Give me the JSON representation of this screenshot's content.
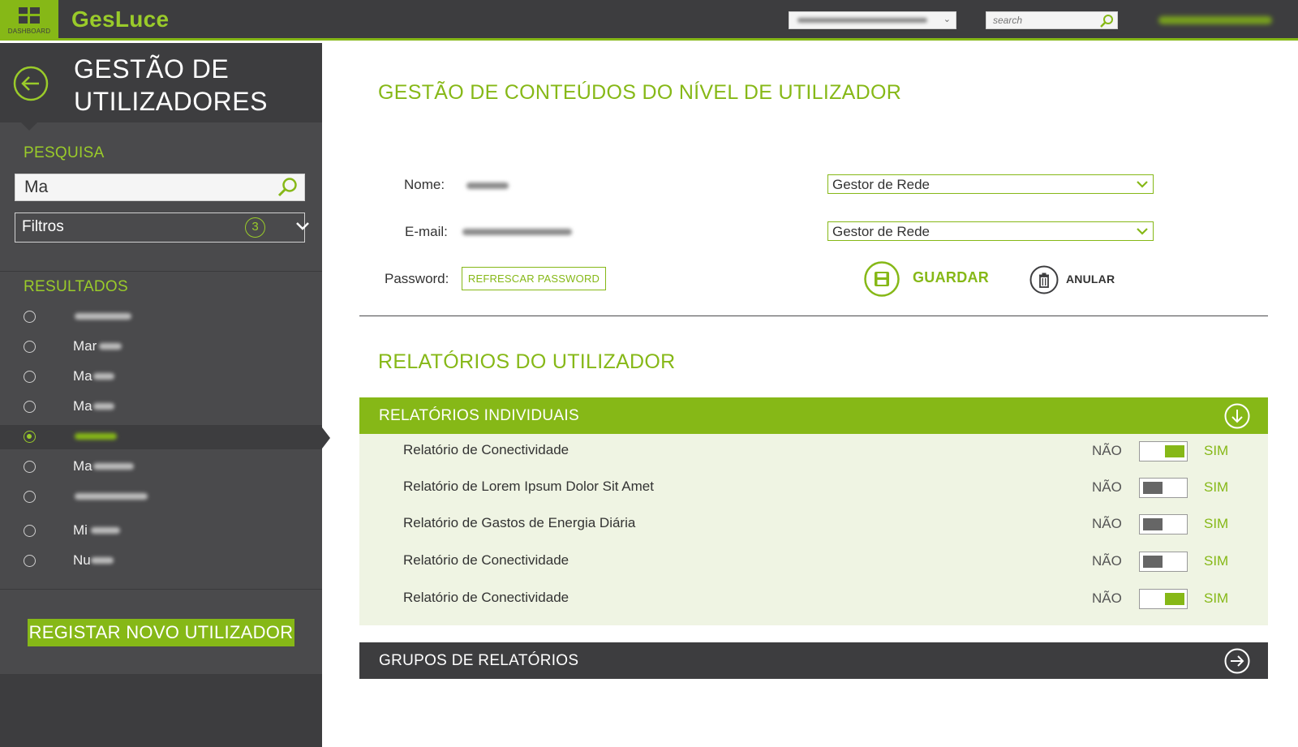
{
  "topbar": {
    "dashboard_label": "DASHBOARD",
    "logo": "GesLuce",
    "search_placeholder": "search"
  },
  "sidebar": {
    "title_line1": "GESTÃO DE",
    "title_line2": "UTILIZADORES",
    "search_label": "PESQUISA",
    "search_value": "Ma",
    "filter_label": "Filtros",
    "filter_count": "3",
    "results_label": "RESULTADOS",
    "results": [
      {
        "visible": ""
      },
      {
        "visible": "Mar"
      },
      {
        "visible": "Ma"
      },
      {
        "visible": "Ma"
      },
      {
        "visible": ""
      },
      {
        "visible": "Ma"
      },
      {
        "visible": ""
      },
      {
        "visible": "Mi"
      },
      {
        "visible": "Nu"
      }
    ],
    "register_button": "REGISTAR NOVO UTILIZADOR"
  },
  "main": {
    "title": "GESTÃO DE CONTEÚDOS DO NÍVEL DE UTILIZADOR",
    "name_label": "Nome:",
    "email_label": "E-mail:",
    "password_label": "Password:",
    "role_select_1": "Gestor de Rede",
    "role_select_2": "Gestor de Rede",
    "refresh_password_button": "REFRESCAR PASSWORD",
    "save_button": "GUARDAR",
    "cancel_button": "ANULAR",
    "reports_title": "RELATÓRIOS DO UTILIZADOR",
    "individual_reports_header": "RELATÓRIOS INDIVIDUAIS",
    "groups_header": "GRUPOS DE RELATÓRIOS",
    "toggle_no": "NÃO",
    "toggle_yes": "SIM",
    "reports": [
      {
        "label": "Relatório de Conectividade",
        "enabled": true
      },
      {
        "label": "Relatório de Lorem Ipsum Dolor Sit Amet",
        "enabled": false
      },
      {
        "label": "Relatório de Gastos de Energia Diária",
        "enabled": false
      },
      {
        "label": "Relatório de Conectividade",
        "enabled": false
      },
      {
        "label": "Relatório de Conectividade",
        "enabled": true
      }
    ]
  },
  "colors": {
    "accent": "#86b817",
    "dark": "#3d3d3f",
    "sidebar": "#4a4a4c",
    "panel_bg": "#eff4e3"
  }
}
